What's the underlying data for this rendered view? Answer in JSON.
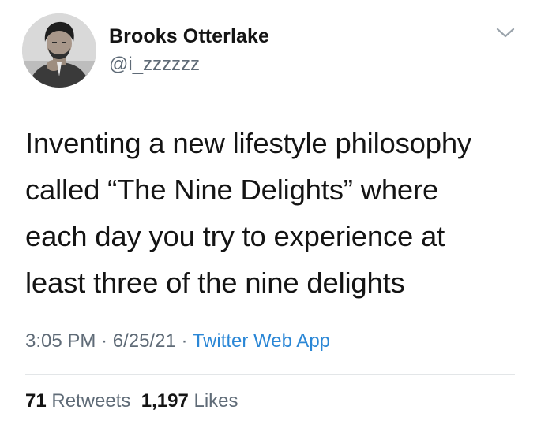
{
  "user": {
    "display_name": "Brooks Otterlake",
    "handle": "@i_zzzzzz"
  },
  "tweet": {
    "lines": [
      "Inventing a new lifestyle philosophy",
      "called “The Nine Delights” where",
      "each day you try to experience at",
      "least three of the nine delights"
    ],
    "time": "3:05 PM",
    "separator": " · ",
    "date": "6/25/21",
    "source": "Twitter Web App"
  },
  "stats": {
    "retweets_count": "71",
    "retweets_label": "Retweets",
    "likes_count": "1,197",
    "likes_label": "Likes"
  },
  "icons": {
    "menu": "chevron-down-icon",
    "avatar": "avatar"
  },
  "colors": {
    "text": "#141414",
    "secondary": "#5f6b77",
    "link": "#2b87d6",
    "divider": "#e3e6e8"
  }
}
